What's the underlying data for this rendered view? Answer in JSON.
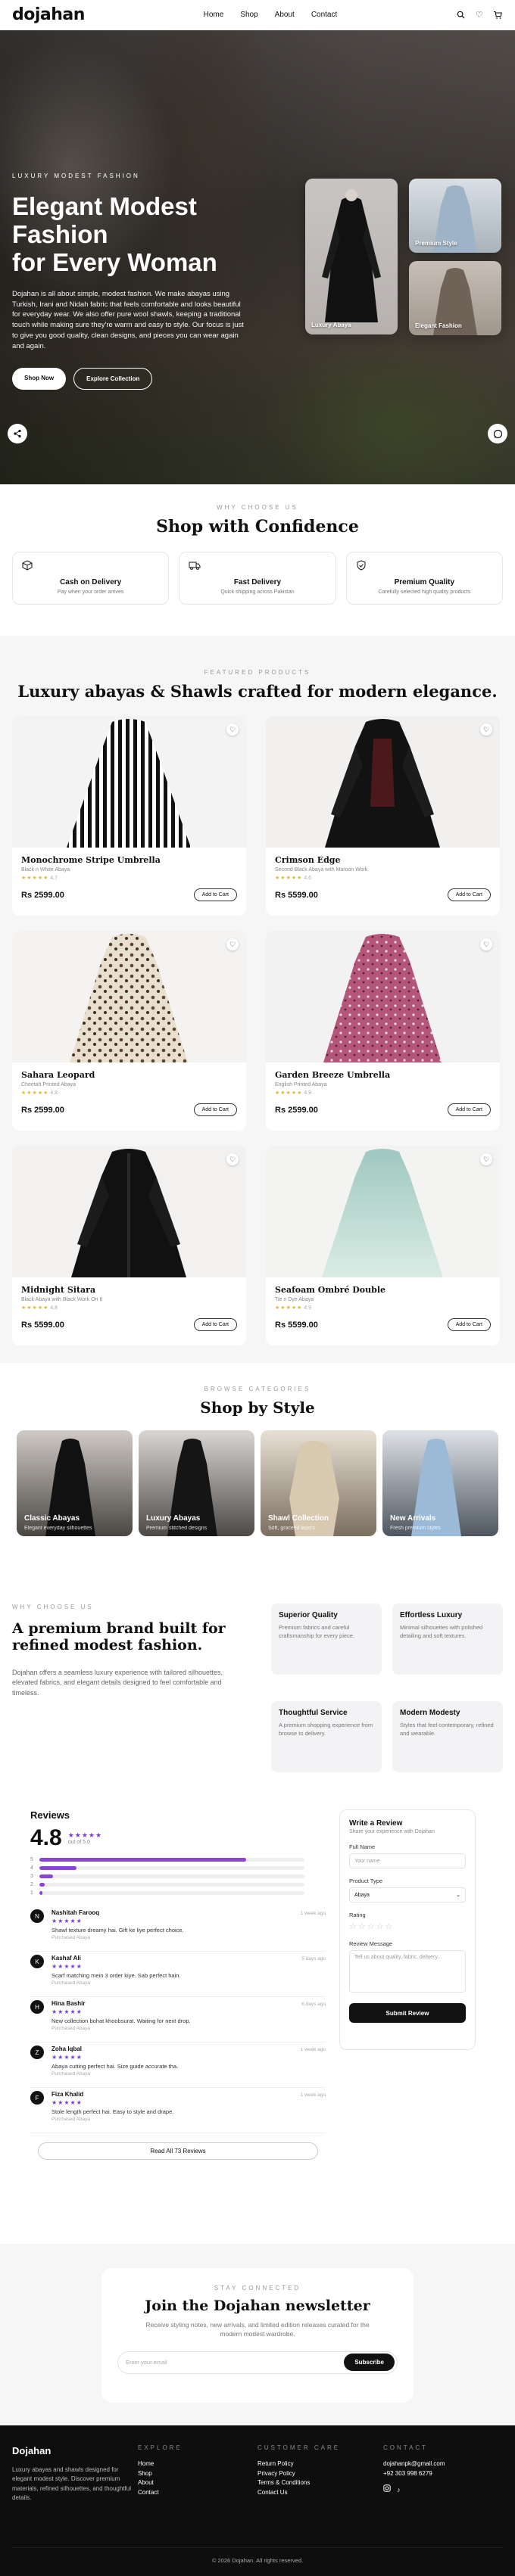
{
  "nav": {
    "logo": "dojahan",
    "links": [
      "Home",
      "Shop",
      "About",
      "Contact"
    ]
  },
  "hero": {
    "kicker": "LUXURY MODEST FASHION",
    "title_line1": "Elegant Modest",
    "title_line2": "Fashion",
    "title_line3": "for Every Woman",
    "description": "Dojahan is all about simple, modest fashion. We make abayas using Turkish, Irani and Nidah fabric that feels comfortable and looks beautiful for everyday wear. We also offer pure wool shawls, keeping a traditional touch while making sure they're warm and easy to style. Our focus is just to give you good quality, clean designs, and pieces you can wear again and again.",
    "primary_button": "Shop Now",
    "secondary_button": "Explore Collection",
    "cards": [
      "Luxury Abaya",
      "Premium Style",
      "Elegant Fashion"
    ]
  },
  "confidence": {
    "kicker": "WHY CHOOSE US",
    "title": "Shop with Confidence",
    "features": [
      {
        "icon": "box-icon",
        "title": "Cash on Delivery",
        "desc": "Pay when your order arrives"
      },
      {
        "icon": "truck-icon",
        "title": "Fast Delivery",
        "desc": "Quick shipping across Pakistan"
      },
      {
        "icon": "shield-check-icon",
        "title": "Premium Quality",
        "desc": "Carefully selected high quality products"
      }
    ]
  },
  "featured": {
    "kicker": "FEATURED PRODUCTS",
    "title": "Luxury abayas & Shawls crafted for modern elegance.",
    "add_to_cart": "Add to Cart",
    "products": [
      {
        "name": "Monochrome Stripe Umbrella",
        "sub": "Black n White Abaya",
        "rating": "4.7",
        "price": "Rs 2599.00"
      },
      {
        "name": "Crimson Edge",
        "sub": "Second Black Abaya with Maroon Work",
        "rating": "4.6",
        "price": "Rs 5599.00"
      },
      {
        "name": "Sahara Leopard",
        "sub": "Cheetah Printed Abaya",
        "rating": "4.8",
        "price": "Rs 2599.00"
      },
      {
        "name": "Garden Breeze Umbrella",
        "sub": "English Printed Abaya",
        "rating": "4.9",
        "price": "Rs 2599.00"
      },
      {
        "name": "Midnight Sitara",
        "sub": "Black Abaya with Black Work On It",
        "rating": "4.8",
        "price": "Rs 5599.00"
      },
      {
        "name": "Seafoam Ombré Double",
        "sub": "Tie n Dye Abaya",
        "rating": "4.9",
        "price": "Rs 5599.00"
      }
    ]
  },
  "categories": {
    "kicker": "BROWSE CATEGORIES",
    "title": "Shop by Style",
    "items": [
      {
        "title": "Classic Abayas",
        "desc": "Elegant everyday silhouettes"
      },
      {
        "title": "Luxury Abayas",
        "desc": "Premium stitched designs"
      },
      {
        "title": "Shawl Collection",
        "desc": "Soft, graceful layers"
      },
      {
        "title": "New Arrivals",
        "desc": "Fresh premium styles"
      }
    ]
  },
  "premium": {
    "kicker": "WHY CHOOSE US",
    "title": "A premium brand built for refined modest fashion.",
    "desc": "Dojahan offers a seamless luxury experience with tailored silhouettes, elevated fabrics, and elegant details designed to feel comfortable and timeless.",
    "cards": [
      {
        "title": "Superior Quality",
        "desc": "Premium fabrics and careful craftsmanship for every piece."
      },
      {
        "title": "Effortless Luxury",
        "desc": "Minimal silhouettes with polished detailing and soft textures."
      },
      {
        "title": "Thoughtful Service",
        "desc": "A premium shopping experience from browse to delivery."
      },
      {
        "title": "Modern Modesty",
        "desc": "Styles that feel contemporary, refined and wearable."
      }
    ]
  },
  "reviews": {
    "heading": "Reviews",
    "score": "4.8",
    "stars": "★★★★★",
    "out_of": "out of 5.0",
    "distribution": [
      {
        "star": "5",
        "pct": 78
      },
      {
        "star": "4",
        "pct": 14
      },
      {
        "star": "3",
        "pct": 5
      },
      {
        "star": "2",
        "pct": 2
      },
      {
        "star": "1",
        "pct": 1
      }
    ],
    "verified": "Purchased Abaya",
    "items": [
      {
        "initial": "N",
        "name": "Nashitah Farooq",
        "stars": "★★★★★",
        "text": "Shawl texture dreamy hai. Gift ke liye perfect choice.",
        "when": "1 week ago"
      },
      {
        "initial": "K",
        "name": "Kashaf Ali",
        "stars": "★★★★★",
        "text": "Scarf matching mein 3 order kiye. Sab perfect hain.",
        "when": "5 days ago"
      },
      {
        "initial": "H",
        "name": "Hina Bashir",
        "stars": "★★★★★",
        "text": "New collection bohat khoobsurat. Waiting for next drop.",
        "when": "6 days ago"
      },
      {
        "initial": "Z",
        "name": "Zoha Iqbal",
        "stars": "★★★★★",
        "text": "Abaya cutting perfect hai. Size guide accurate tha.",
        "when": "1 week ago"
      },
      {
        "initial": "F",
        "name": "Fiza Khalid",
        "stars": "★★★★★",
        "text": "Stole length perfect hai. Easy to style and drape.",
        "when": "1 week ago"
      }
    ],
    "read_all": "Read All 73 Reviews"
  },
  "review_form": {
    "title": "Write a Review",
    "subtitle": "Share your experience with Dojahan",
    "name_label": "Full Name",
    "name_placeholder": "Your name",
    "type_label": "Product Type",
    "type_value": "Abaya",
    "rating_label": "Rating",
    "rating_stars": "☆☆☆☆☆",
    "message_label": "Review Message",
    "message_placeholder": "Tell us about quality, fabric, delivery...",
    "submit": "Submit Review"
  },
  "newsletter": {
    "kicker": "STAY CONNECTED",
    "title": "Join the Dojahan newsletter",
    "desc": "Receive styling notes, new arrivals, and limited edition releases curated for the modern modest wardrobe.",
    "placeholder": "Enter your email",
    "button": "Subscribe"
  },
  "footer": {
    "brand": "Dojahan",
    "brand_desc": "Luxury abayas and shawls designed for elegant modest style. Discover premium materials, refined silhouettes, and thoughtful details.",
    "explore_h": "EXPLORE",
    "explore": [
      "Home",
      "Shop",
      "About",
      "Contact"
    ],
    "care_h": "CUSTOMER CARE",
    "care": [
      "Return Policy",
      "Privacy Policy",
      "Terms & Conditions",
      "Contact Us"
    ],
    "contact_h": "CONTACT",
    "email": "dojahanpk@gmail.com",
    "phone": "+92 303 998 6279",
    "copyright": "© 2026 Dojahan. All rights reserved."
  }
}
